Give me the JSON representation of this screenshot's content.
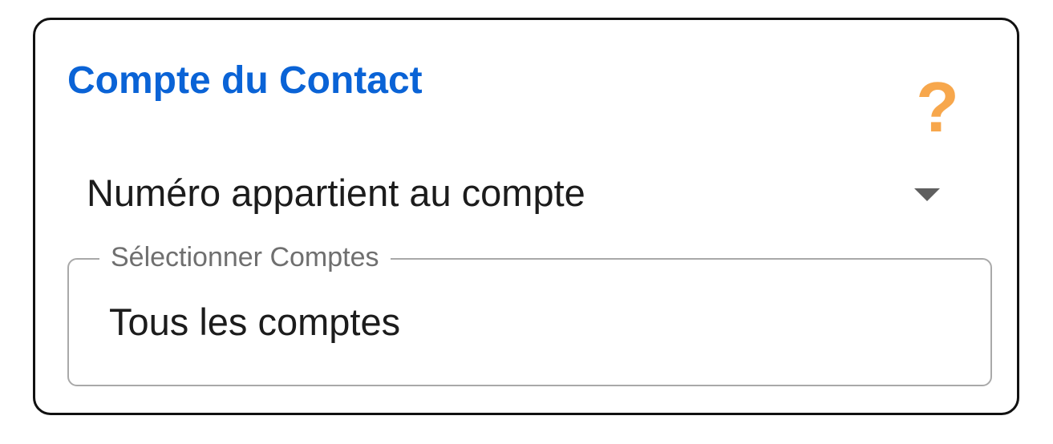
{
  "card": {
    "title": "Compte du Contact",
    "help_icon": "question-mark",
    "help_icon_glyph": "?",
    "title_color": "#0a63d6",
    "help_color": "#f7a74c"
  },
  "filter_select": {
    "selected": "Numéro appartient au compte",
    "icon": "chevron-down"
  },
  "accounts_field": {
    "label": "Sélectionner Comptes",
    "value": "Tous les comptes"
  }
}
